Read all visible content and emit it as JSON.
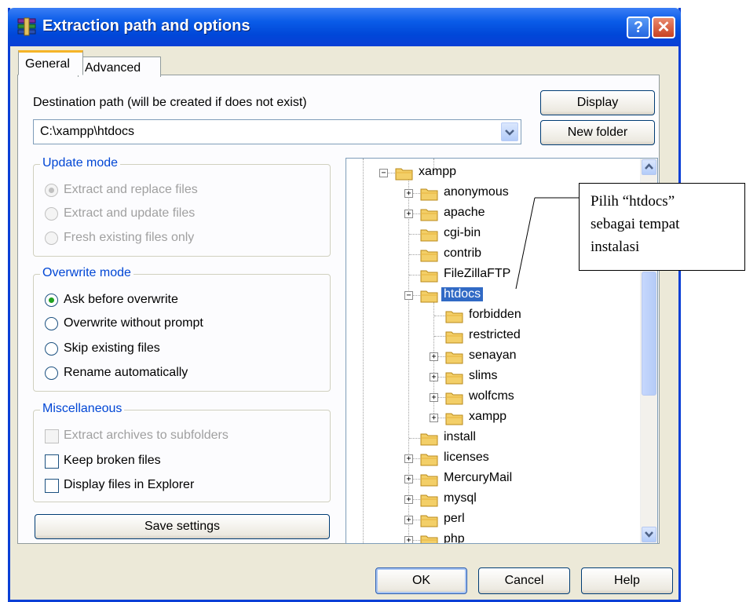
{
  "window": {
    "title": "Extraction path and options",
    "help_label": "?",
    "close_label": "✕"
  },
  "tabs": [
    {
      "label": "General",
      "active": true
    },
    {
      "label": "Advanced",
      "active": false
    }
  ],
  "destination": {
    "label": "Destination path (will be created if does not exist)",
    "value": "C:\\xampp\\htdocs"
  },
  "buttons": {
    "display": "Display",
    "new_folder": "New folder",
    "save_settings": "Save settings",
    "ok": "OK",
    "cancel": "Cancel",
    "help": "Help"
  },
  "update_mode": {
    "title": "Update mode",
    "options": [
      {
        "label": "Extract and replace files",
        "selected": true,
        "disabled": true
      },
      {
        "label": "Extract and update files",
        "selected": false,
        "disabled": true
      },
      {
        "label": "Fresh existing files only",
        "selected": false,
        "disabled": true
      }
    ]
  },
  "overwrite_mode": {
    "title": "Overwrite mode",
    "options": [
      {
        "label": "Ask before overwrite",
        "selected": true
      },
      {
        "label": "Overwrite without prompt",
        "selected": false
      },
      {
        "label": "Skip existing files",
        "selected": false
      },
      {
        "label": "Rename automatically",
        "selected": false
      }
    ]
  },
  "misc": {
    "title": "Miscellaneous",
    "options": [
      {
        "label": "Extract archives to subfolders",
        "checked": false,
        "disabled": true
      },
      {
        "label": "Keep broken files",
        "checked": false,
        "disabled": false
      },
      {
        "label": "Display files in Explorer",
        "checked": false,
        "disabled": false
      }
    ]
  },
  "tree": {
    "items": [
      {
        "label": "xampp",
        "expander": "−"
      },
      {
        "label": "anonymous",
        "expander": "+"
      },
      {
        "label": "apache",
        "expander": "+"
      },
      {
        "label": "cgi-bin",
        "expander": ""
      },
      {
        "label": "contrib",
        "expander": ""
      },
      {
        "label": "FileZillaFTP",
        "expander": ""
      },
      {
        "label": "htdocs",
        "expander": "−",
        "selected": true
      },
      {
        "label": "forbidden",
        "expander": ""
      },
      {
        "label": "restricted",
        "expander": ""
      },
      {
        "label": "senayan",
        "expander": "+"
      },
      {
        "label": "slims",
        "expander": "+"
      },
      {
        "label": "wolfcms",
        "expander": "+"
      },
      {
        "label": "xampp",
        "expander": "+"
      },
      {
        "label": "install",
        "expander": ""
      },
      {
        "label": "licenses",
        "expander": "+"
      },
      {
        "label": "MercuryMail",
        "expander": "+"
      },
      {
        "label": "mysql",
        "expander": "+"
      },
      {
        "label": "perl",
        "expander": "+"
      },
      {
        "label": "php",
        "expander": "+"
      }
    ]
  },
  "callout": {
    "text": "Pilih “htdocs”\nsebagai tempat\ninstalasi"
  },
  "icons": {
    "title": "archive-books-icon",
    "folder": "folder-icon",
    "combo": "chevron-down-icon",
    "scroll_up": "scroll-up-icon",
    "scroll_down": "scroll-down-icon"
  },
  "colors": {
    "titlebar": "#0a5ce8",
    "selection": "#316ac5",
    "group_title": "#0046d5",
    "radio_dot": "#21a121",
    "folder": "#f3cf68"
  }
}
